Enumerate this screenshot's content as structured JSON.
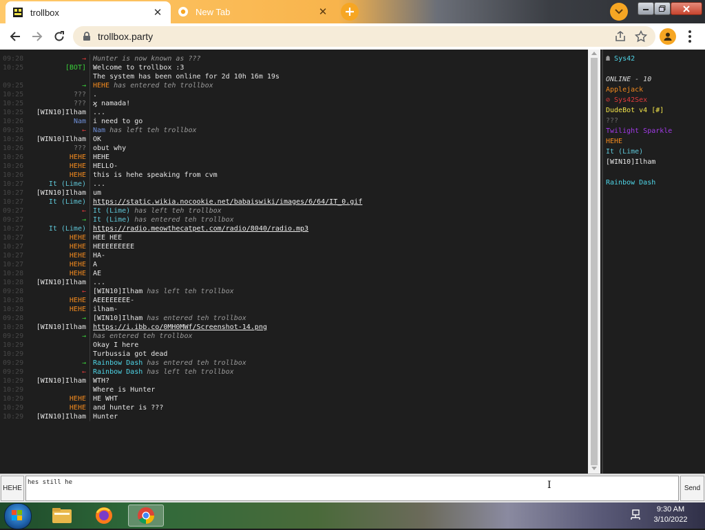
{
  "browser": {
    "tabs": [
      {
        "label": "trollbox",
        "active": true
      },
      {
        "label": "New Tab",
        "active": false
      }
    ],
    "url": "trollbox.party"
  },
  "chat": {
    "messages": [
      {
        "time": "09:28",
        "nick": "→",
        "nick_color": "#e23b3b",
        "segments": [
          {
            "t": "Hunter",
            "c": "#9a9a9a",
            "i": true
          },
          {
            "t": " is now known as ",
            "c": "#9a9a9a",
            "i": true
          },
          {
            "t": "???",
            "c": "#9a9a9a",
            "i": true
          }
        ]
      },
      {
        "time": "10:25",
        "nick": "[BOT]",
        "nick_color": "#3ad13a",
        "segments": [
          {
            "t": "Welcome to trollbox :3",
            "c": "#e6e6e6"
          }
        ]
      },
      {
        "time": "",
        "nick": "",
        "nick_color": "#e6e6e6",
        "segments": [
          {
            "t": "The system has been online for 2d 10h 16m 19s",
            "c": "#e6e6e6"
          }
        ]
      },
      {
        "time": "09:25",
        "nick": "→",
        "nick_color": "#3ad13a",
        "segments": [
          {
            "t": "HEHE",
            "c": "#f28a1e"
          },
          {
            "t": " has entered teh trollbox",
            "c": "#9a9a9a",
            "i": true
          }
        ]
      },
      {
        "time": "10:25",
        "nick": "???",
        "nick_color": "#7d7d7d",
        "segments": [
          {
            "t": ".",
            "c": "#e6e6e6"
          }
        ]
      },
      {
        "time": "10:25",
        "nick": "???",
        "nick_color": "#7d7d7d",
        "segments": [
          {
            "t": "ϗ namada!",
            "c": "#e6e6e6"
          }
        ]
      },
      {
        "time": "10:25",
        "nick": "[WIN10]Ilham",
        "nick_color": "#e6e6e6",
        "segments": [
          {
            "t": "...",
            "c": "#e6e6e6"
          }
        ]
      },
      {
        "time": "10:26",
        "nick": "Nam",
        "nick_color": "#6f8fd8",
        "segments": [
          {
            "t": "i need to go",
            "c": "#e6e6e6"
          }
        ]
      },
      {
        "time": "09:28",
        "nick": "←",
        "nick_color": "#e23b3b",
        "segments": [
          {
            "t": "Nam",
            "c": "#6f8fd8"
          },
          {
            "t": " has left teh trollbox",
            "c": "#9a9a9a",
            "i": true
          }
        ]
      },
      {
        "time": "10:26",
        "nick": "[WIN10]Ilham",
        "nick_color": "#e6e6e6",
        "segments": [
          {
            "t": "OK",
            "c": "#e6e6e6"
          }
        ]
      },
      {
        "time": "10:26",
        "nick": "???",
        "nick_color": "#7d7d7d",
        "segments": [
          {
            "t": "obut why",
            "c": "#e6e6e6"
          }
        ]
      },
      {
        "time": "10:26",
        "nick": "HEHE",
        "nick_color": "#f28a1e",
        "segments": [
          {
            "t": "HEHE",
            "c": "#e6e6e6"
          }
        ]
      },
      {
        "time": "10:26",
        "nick": "HEHE",
        "nick_color": "#f28a1e",
        "segments": [
          {
            "t": "HELLO-",
            "c": "#e6e6e6"
          }
        ]
      },
      {
        "time": "10:26",
        "nick": "HEHE",
        "nick_color": "#f28a1e",
        "segments": [
          {
            "t": "this is hehe speaking from cvm",
            "c": "#e6e6e6"
          }
        ]
      },
      {
        "time": "10:27",
        "nick": "It (Lime)",
        "nick_color": "#5fc7d8",
        "segments": [
          {
            "t": "...",
            "c": "#e6e6e6"
          }
        ]
      },
      {
        "time": "10:27",
        "nick": "[WIN10]Ilham",
        "nick_color": "#e6e6e6",
        "segments": [
          {
            "t": "um",
            "c": "#e6e6e6"
          }
        ]
      },
      {
        "time": "10:27",
        "nick": "It (Lime)",
        "nick_color": "#5fc7d8",
        "segments": [
          {
            "t": "https://static.wikia.nocookie.net/babaiswiki/images/6/64/IT_0.gif",
            "c": "#f0f0f0",
            "u": true
          }
        ]
      },
      {
        "time": "09:27",
        "nick": "←",
        "nick_color": "#e23b3b",
        "segments": [
          {
            "t": "It (Lime)",
            "c": "#5fc7d8"
          },
          {
            "t": " has left teh trollbox",
            "c": "#9a9a9a",
            "i": true
          }
        ]
      },
      {
        "time": "09:27",
        "nick": "→",
        "nick_color": "#3ad13a",
        "segments": [
          {
            "t": "It (Lime)",
            "c": "#5fc7d8"
          },
          {
            "t": " has entered teh trollbox",
            "c": "#9a9a9a",
            "i": true
          }
        ]
      },
      {
        "time": "10:27",
        "nick": "It (Lime)",
        "nick_color": "#5fc7d8",
        "segments": [
          {
            "t": "https://radio.meowthecatpet.com/radio/8040/radio.mp3",
            "c": "#f0f0f0",
            "u": true
          }
        ]
      },
      {
        "time": "10:27",
        "nick": "HEHE",
        "nick_color": "#f28a1e",
        "segments": [
          {
            "t": "HEE HEE",
            "c": "#e6e6e6"
          }
        ]
      },
      {
        "time": "10:27",
        "nick": "HEHE",
        "nick_color": "#f28a1e",
        "segments": [
          {
            "t": "HEEEEEEEEE",
            "c": "#e6e6e6"
          }
        ]
      },
      {
        "time": "10:27",
        "nick": "HEHE",
        "nick_color": "#f28a1e",
        "segments": [
          {
            "t": "HA-",
            "c": "#e6e6e6"
          }
        ]
      },
      {
        "time": "10:27",
        "nick": "HEHE",
        "nick_color": "#f28a1e",
        "segments": [
          {
            "t": "A",
            "c": "#e6e6e6"
          }
        ]
      },
      {
        "time": "10:28",
        "nick": "HEHE",
        "nick_color": "#f28a1e",
        "segments": [
          {
            "t": "AE",
            "c": "#e6e6e6"
          }
        ]
      },
      {
        "time": "10:28",
        "nick": "[WIN10]Ilham",
        "nick_color": "#e6e6e6",
        "segments": [
          {
            "t": "...",
            "c": "#e6e6e6"
          }
        ]
      },
      {
        "time": "09:28",
        "nick": "←",
        "nick_color": "#e23b3b",
        "segments": [
          {
            "t": "[WIN10]Ilham",
            "c": "#e6e6e6"
          },
          {
            "t": " has left teh trollbox",
            "c": "#9a9a9a",
            "i": true
          }
        ]
      },
      {
        "time": "10:28",
        "nick": "HEHE",
        "nick_color": "#f28a1e",
        "segments": [
          {
            "t": "AEEEEEEEE-",
            "c": "#e6e6e6"
          }
        ]
      },
      {
        "time": "10:28",
        "nick": "HEHE",
        "nick_color": "#f28a1e",
        "segments": [
          {
            "t": "ilham-",
            "c": "#e6e6e6"
          }
        ]
      },
      {
        "time": "09:28",
        "nick": "→",
        "nick_color": "#3ad13a",
        "segments": [
          {
            "t": "[WIN10]Ilham",
            "c": "#e6e6e6"
          },
          {
            "t": " has entered teh trollbox",
            "c": "#9a9a9a",
            "i": true
          }
        ]
      },
      {
        "time": "10:28",
        "nick": "[WIN10]Ilham",
        "nick_color": "#e6e6e6",
        "segments": [
          {
            "t": "https://i.ibb.co/0MH0MWf/Screenshot-14.png",
            "c": "#f0f0f0",
            "u": true
          }
        ]
      },
      {
        "time": "09:29",
        "nick": "→",
        "nick_color": "#3ad13a",
        "segments": [
          {
            "t": "",
            "c": "#1b3fc4"
          },
          {
            "t": " has entered teh trollbox",
            "c": "#9a9a9a",
            "i": true
          }
        ]
      },
      {
        "time": "10:29",
        "nick": "",
        "nick_color": "#1b3fc4",
        "segments": [
          {
            "t": "Okay I here",
            "c": "#e6e6e6"
          }
        ]
      },
      {
        "time": "10:29",
        "nick": "",
        "nick_color": "#1b3fc4",
        "segments": [
          {
            "t": "Turbussia got dead",
            "c": "#e6e6e6"
          }
        ]
      },
      {
        "time": "09:29",
        "nick": "→",
        "nick_color": "#3ad13a",
        "segments": [
          {
            "t": "Rainbow Dash",
            "c": "#4fd6e8"
          },
          {
            "t": " has entered teh trollbox",
            "c": "#9a9a9a",
            "i": true
          }
        ]
      },
      {
        "time": "09:29",
        "nick": "←",
        "nick_color": "#e23b3b",
        "segments": [
          {
            "t": "Rainbow Dash",
            "c": "#4fd6e8"
          },
          {
            "t": " has left teh trollbox",
            "c": "#9a9a9a",
            "i": true
          }
        ]
      },
      {
        "time": "10:29",
        "nick": "[WIN10]Ilham",
        "nick_color": "#e6e6e6",
        "segments": [
          {
            "t": "WTH?",
            "c": "#e6e6e6"
          }
        ]
      },
      {
        "time": "10:29",
        "nick": "",
        "nick_color": "#1b3fc4",
        "segments": [
          {
            "t": "Where is Hunter",
            "c": "#e6e6e6"
          }
        ]
      },
      {
        "time": "10:29",
        "nick": "HEHE",
        "nick_color": "#f28a1e",
        "segments": [
          {
            "t": "HE WHT",
            "c": "#e6e6e6"
          }
        ]
      },
      {
        "time": "10:29",
        "nick": "HEHE",
        "nick_color": "#f28a1e",
        "segments": [
          {
            "t": "and hunter is ???",
            "c": "#e6e6e6"
          }
        ]
      },
      {
        "time": "10:29",
        "nick": "[WIN10]Ilham",
        "nick_color": "#e6e6e6",
        "segments": [
          {
            "t": "Hunter",
            "c": "#e6e6e6"
          }
        ]
      }
    ]
  },
  "userlist": {
    "room": "Sys42",
    "room_color": "#4fd6e8",
    "online_label": "ONLINE - 10",
    "users": [
      {
        "name": "Applejack",
        "color": "#f28a1e"
      },
      {
        "name": "⊘ Sys42Sex",
        "color": "#e23b3b"
      },
      {
        "name": "DudeBot v4 [#]",
        "color": "#f2e44a"
      },
      {
        "name": "???",
        "color": "#6f6f6f"
      },
      {
        "name": "Twilight Sparkle",
        "color": "#a23be8"
      },
      {
        "name": "HEHE",
        "color": "#f28a1e"
      },
      {
        "name": "It (Lime)",
        "color": "#5fc7d8"
      },
      {
        "name": "[WIN10]Ilham",
        "color": "#e6e6e6"
      },
      {
        "name": "",
        "color": "#1b3fc4"
      },
      {
        "name": "Rainbow Dash",
        "color": "#4fd6e8"
      }
    ]
  },
  "input": {
    "nick_label": "HEHE",
    "value": "hes still he",
    "send_label": "Send"
  },
  "taskbar": {
    "time": "9:30 AM",
    "date": "3/10/2022"
  }
}
